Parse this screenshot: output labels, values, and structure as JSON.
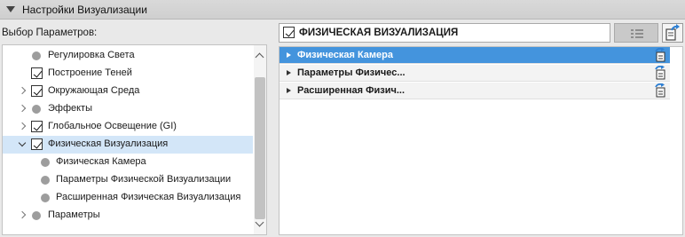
{
  "panel": {
    "title": "Настройки Визуализации"
  },
  "left": {
    "label": "Выбор Параметров:",
    "tree": [
      {
        "label": "Регулировка Света",
        "kind": "dot",
        "expander": "none"
      },
      {
        "label": "Построение Теней",
        "kind": "check",
        "expander": "none"
      },
      {
        "label": "Окружающая Среда",
        "kind": "check",
        "expander": "closed"
      },
      {
        "label": "Эффекты",
        "kind": "dot",
        "expander": "closed"
      },
      {
        "label": "Глобальное Освещение (GI)",
        "kind": "check",
        "expander": "closed"
      },
      {
        "label": "Физическая Визуализация",
        "kind": "check",
        "expander": "open",
        "selected": true
      },
      {
        "label": "Физическая Камера",
        "kind": "dot",
        "expander": "none",
        "child": true
      },
      {
        "label": "Параметры Физической Визуализации",
        "kind": "dot",
        "expander": "none",
        "child": true
      },
      {
        "label": "Расширенная Физическая Визуализация",
        "kind": "dot",
        "expander": "none",
        "child": true
      },
      {
        "label": "Параметры",
        "kind": "dot",
        "expander": "closed"
      }
    ]
  },
  "right": {
    "header": "ФИЗИЧЕСКАЯ ВИЗУАЛИЗАЦИЯ",
    "rows": [
      {
        "label": "Физическая Камера",
        "active": true
      },
      {
        "label": "Параметры Физичес...",
        "active": false
      },
      {
        "label": "Расширенная Физич...",
        "active": false
      }
    ]
  },
  "colors": {
    "selection": "#d3e6f8",
    "active_row": "#4494dd",
    "icon_blue": "#2d7fd3"
  }
}
